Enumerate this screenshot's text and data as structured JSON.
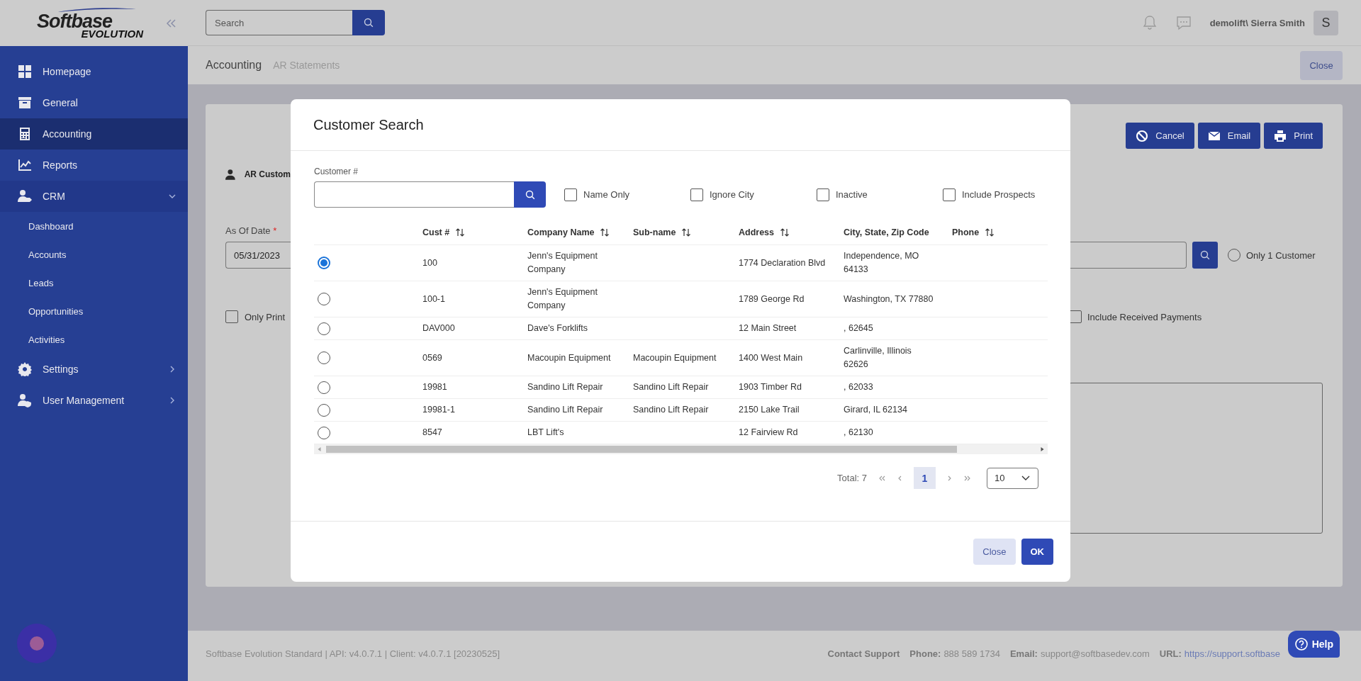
{
  "sidebar": {
    "logo": {
      "name": "Softbase",
      "sub": "EVOLUTION"
    },
    "items": [
      {
        "label": "Homepage",
        "kind": "link",
        "selected": false
      },
      {
        "label": "General",
        "kind": "link",
        "selected": false
      },
      {
        "label": "Accounting",
        "kind": "link",
        "selected": true
      },
      {
        "label": "Reports",
        "kind": "link",
        "selected": false
      },
      {
        "label": "CRM",
        "kind": "group",
        "selected": false,
        "expanded": true,
        "children": [
          {
            "label": "Dashboard"
          },
          {
            "label": "Accounts"
          },
          {
            "label": "Leads"
          },
          {
            "label": "Opportunities"
          },
          {
            "label": "Activities"
          }
        ]
      },
      {
        "label": "Settings",
        "kind": "group",
        "selected": false,
        "expanded": false
      },
      {
        "label": "User Management",
        "kind": "group",
        "selected": false,
        "expanded": false
      }
    ]
  },
  "topbar": {
    "search": {
      "placeholder": "Search"
    },
    "user": {
      "name": "demolift\\ Sierra Smith",
      "avatar": "S"
    }
  },
  "breadcrumb": [
    {
      "label": "Accounting"
    },
    {
      "label": "AR Statements"
    }
  ],
  "page_close": "Close",
  "form": {
    "actions": [
      {
        "label": "Cancel"
      },
      {
        "label": "Email"
      },
      {
        "label": "Print"
      }
    ],
    "section_title": "AR Custom",
    "date_label": "As Of Date",
    "required_mark": "*",
    "date_value": "05/31/2023",
    "only_print": {
      "label": "Only Print",
      "checked": false
    },
    "only_one_customer": {
      "label": "Only 1 Customer",
      "selected": false
    },
    "include_received": {
      "label": "Include Received Payments",
      "checked": false
    }
  },
  "dialog": {
    "title": "Customer Search",
    "field_label": "Customer #",
    "options": [
      {
        "label": "Name Only",
        "checked": false
      },
      {
        "label": "Ignore City",
        "checked": false
      },
      {
        "label": "Inactive",
        "checked": false
      },
      {
        "label": "Include Prospects",
        "checked": false
      }
    ],
    "table": {
      "columns": [
        {
          "label": "Cust #",
          "sortable": true
        },
        {
          "label": "Company Name",
          "sortable": true
        },
        {
          "label": "Sub-name",
          "sortable": true
        },
        {
          "label": "Address",
          "sortable": true
        },
        {
          "label": "City, State, Zip Code",
          "sortable": false
        },
        {
          "label": "Phone",
          "sortable": true
        }
      ],
      "rows": [
        {
          "selected": true,
          "cells": [
            "100",
            "Jenn's Equipment Company",
            "",
            "1774 Declaration Blvd",
            "Independence, MO 64133",
            ""
          ]
        },
        {
          "selected": false,
          "cells": [
            "100-1",
            "Jenn's Equipment Company",
            "",
            "1789 George Rd",
            "Washington, TX 77880",
            ""
          ]
        },
        {
          "selected": false,
          "cells": [
            "DAV000",
            "Dave's Forklifts",
            "",
            "12 Main Street",
            ", 62645",
            ""
          ]
        },
        {
          "selected": false,
          "cells": [
            "0569",
            "Macoupin Equipment",
            "Macoupin Equipment",
            "1400 West Main",
            "Carlinville, Illinois 62626",
            ""
          ]
        },
        {
          "selected": false,
          "cells": [
            "19981",
            "Sandino Lift Repair",
            "Sandino Lift Repair",
            "1903 Timber Rd",
            ", 62033",
            ""
          ]
        },
        {
          "selected": false,
          "cells": [
            "19981-1",
            "Sandino Lift Repair",
            "Sandino Lift Repair",
            "2150 Lake Trail",
            "Girard, IL 62134",
            ""
          ]
        },
        {
          "selected": false,
          "cells": [
            "8547",
            "LBT Lift's",
            "",
            "12 Fairview Rd",
            ", 62130",
            ""
          ]
        }
      ]
    },
    "pagination": {
      "total": "Total: 7",
      "pages": [
        {
          "label": "1",
          "selected": true
        }
      ],
      "page_size": "10"
    },
    "buttons": [
      {
        "label": "Close",
        "kind": "secondary"
      },
      {
        "label": "OK",
        "kind": "primary"
      }
    ]
  },
  "footer": {
    "version": "Softbase Evolution Standard | API: v4.0.7.1 | Client: v4.0.7.1 [20230525]",
    "support_title": "Contact Support",
    "fields": [
      {
        "label": "Phone:",
        "value": "888 589 1734",
        "kind": "text"
      },
      {
        "label": "Email:",
        "value": "support@softbasedev.com",
        "kind": "text"
      },
      {
        "label": "URL:",
        "value": "https://support.softbase",
        "kind": "link"
      }
    ]
  },
  "help": {
    "label": "Help"
  }
}
